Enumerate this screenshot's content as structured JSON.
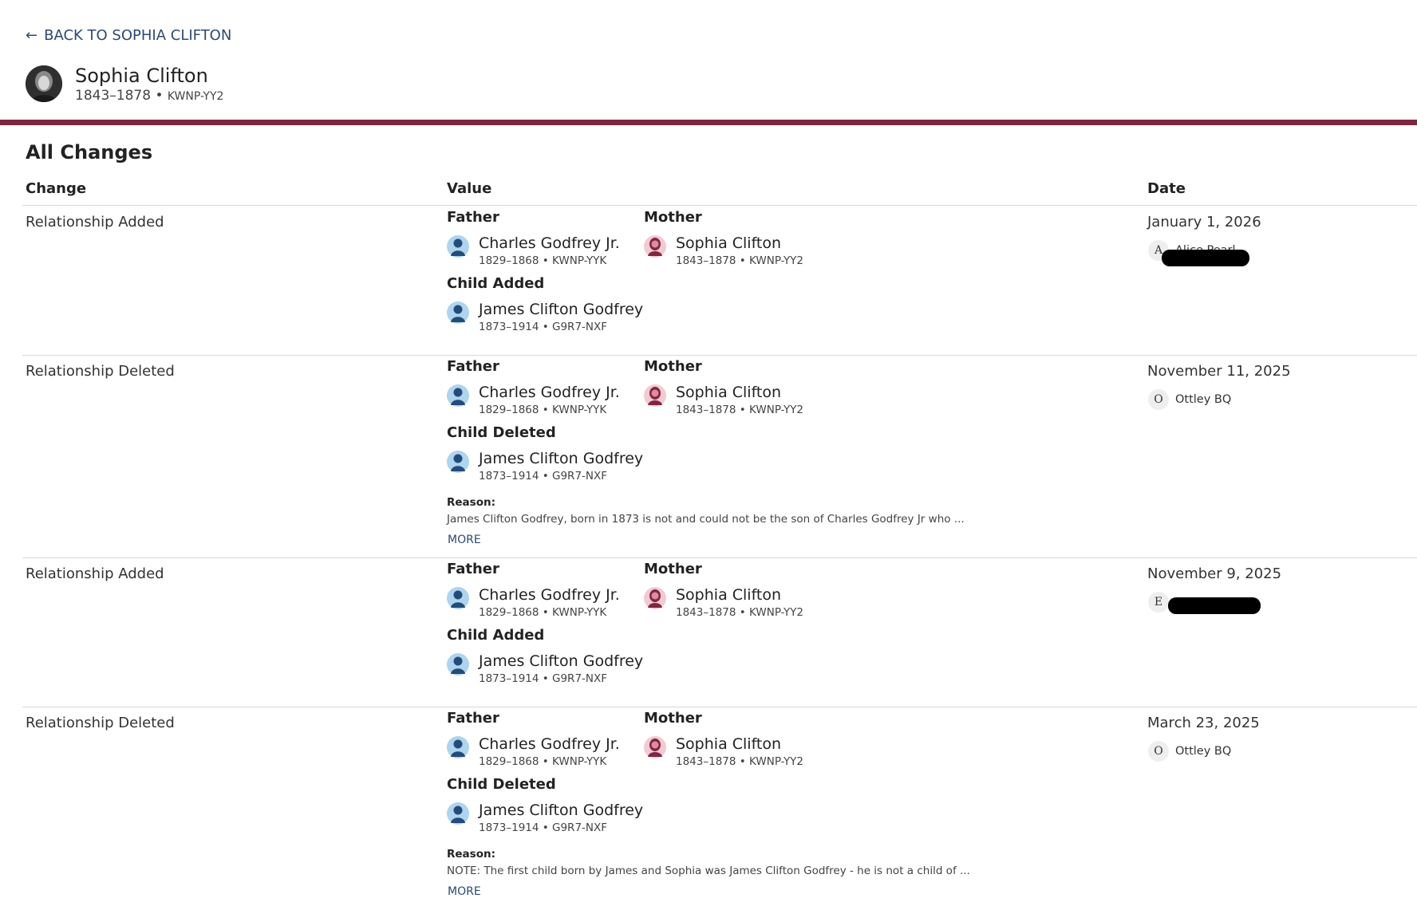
{
  "nav": {
    "back_label": "BACK TO SOPHIA CLIFTON"
  },
  "person": {
    "name": "Sophia Clifton",
    "lifespan": "1843–1878",
    "id": "KWNP-YY2"
  },
  "section_title": "All Changes",
  "columns": {
    "change": "Change",
    "value": "Value",
    "date": "Date"
  },
  "labels": {
    "father": "Father",
    "mother": "Mother",
    "child_added": "Child Added",
    "child_deleted": "Child Deleted",
    "reason": "Reason:",
    "more": "MORE"
  },
  "people": {
    "father": {
      "name": "Charles Godfrey Jr.",
      "meta": "1829–1868 • KWNP-YYK"
    },
    "mother": {
      "name": "Sophia Clifton",
      "meta": "1843–1878 • KWNP-YY2"
    },
    "child": {
      "name": "James Clifton Godfrey",
      "meta": "1873–1914 • G9R7-NXF"
    }
  },
  "changes": [
    {
      "type": "Relationship Added",
      "date": "January 1, 2026",
      "contributor_initial": "A",
      "contributor_name": "Alice Pearl"
    },
    {
      "type": "Relationship Deleted",
      "date": "November 11, 2025",
      "contributor_initial": "O",
      "contributor_name": "Ottley BQ",
      "reason": "James Clifton Godfrey, born in 1873 is not and could not be the son of Charles Godfrey Jr who ..."
    },
    {
      "type": "Relationship Added",
      "date": "November 9, 2025",
      "contributor_initial": "E",
      "contributor_name": ""
    },
    {
      "type": "Relationship Deleted",
      "date": "March 23, 2025",
      "contributor_initial": "O",
      "contributor_name": "Ottley BQ",
      "reason": "NOTE: The first child born by James and Sophia was James Clifton Godfrey - he is not a child of ..."
    }
  ],
  "colors": {
    "accent": "#7d2842",
    "link": "#2d4a6f",
    "male_avatar_bg": "#aed4ee",
    "female_avatar_bg": "#f5c9d2"
  },
  "icons": {
    "back": "arrow-left-icon",
    "male": "male-silhouette-icon",
    "female": "female-silhouette-icon"
  }
}
